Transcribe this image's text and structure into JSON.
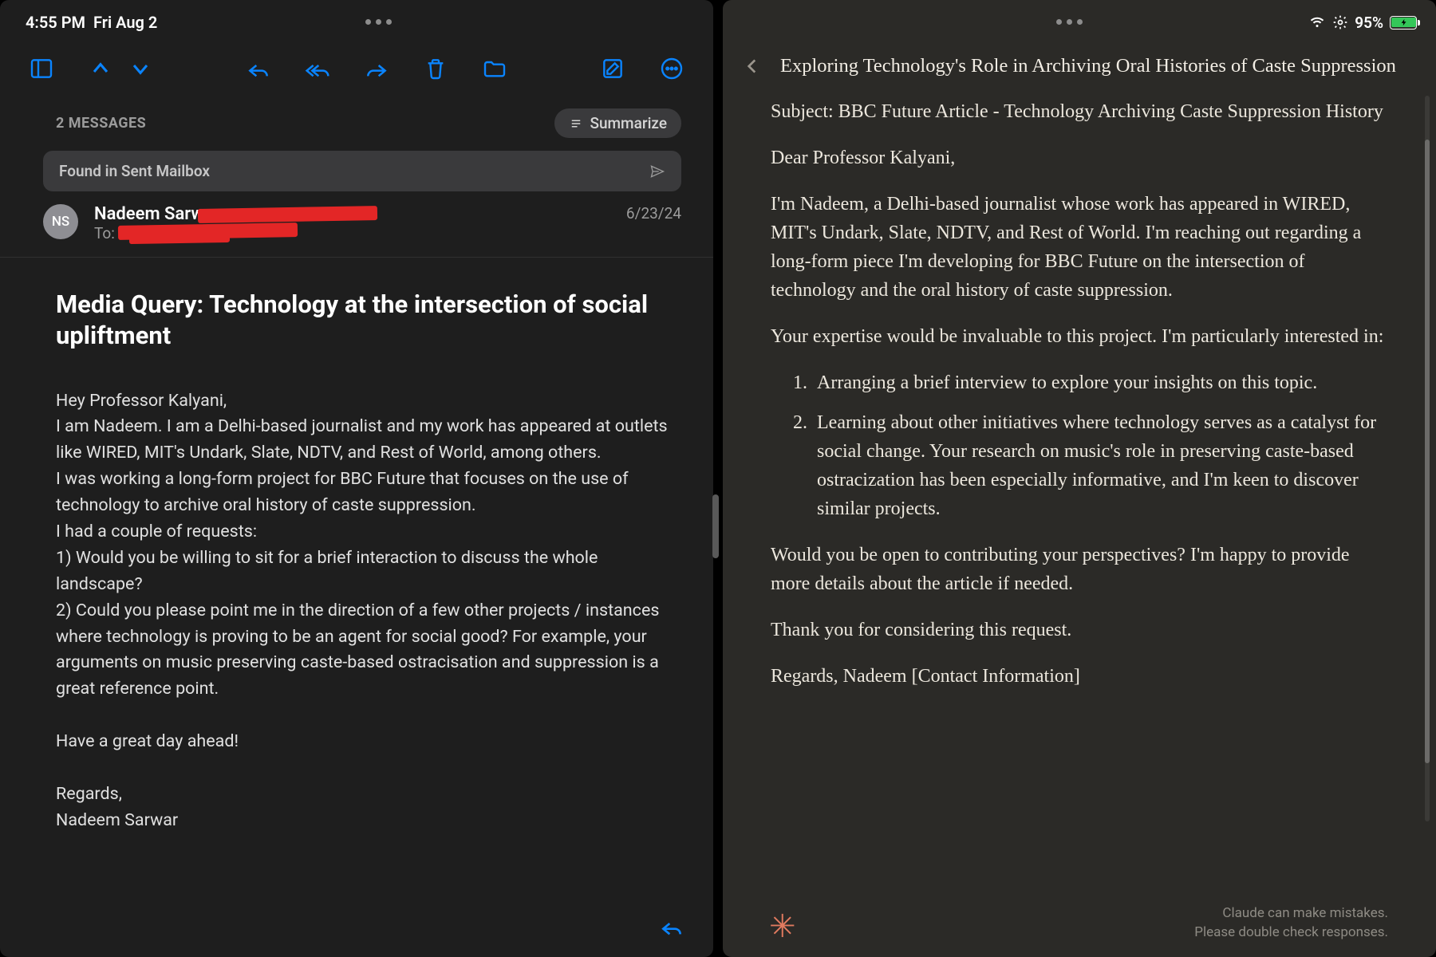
{
  "status_bar": {
    "time": "4:55 PM",
    "date": "Fri Aug 2",
    "battery_pct": "95%"
  },
  "mail": {
    "msg_count": "2 MESSAGES",
    "summarize_label": "Summarize",
    "found_banner": "Found in Sent Mailbox",
    "sender": {
      "initials": "NS",
      "name": "Nadeem Sarwar",
      "to_label": "To:",
      "date": "6/23/24"
    },
    "subject": "Media Query: Technology at the intersection of social upliftment",
    "body": "Hey Professor Kalyani,\nI am Nadeem. I am a Delhi-based journalist and my work has appeared at outlets like WIRED, MIT's Undark, Slate, NDTV, and Rest of World, among others.\nI was working a long-form project for BBC Future that focuses on the use of technology to archive oral history of caste suppression.\nI had a couple of requests:\n1) Would you be willing to sit for a brief interaction to discuss the whole landscape?\n2) Could you please point me in the direction of a few other projects / instances where technology is proving to be an agent for social good? For example, your arguments on music preserving caste-based ostracisation and suppression is a great reference point.\n\nHave a great day ahead!\n\nRegards,\nNadeem Sarwar"
  },
  "chat": {
    "title": "Exploring Technology's Role in Archiving Oral Histories of Caste Suppression",
    "response": {
      "subject_line": "Subject: BBC Future Article - Technology Archiving Caste Suppression History",
      "greeting": "Dear Professor Kalyani,",
      "intro": "I'm Nadeem, a Delhi-based journalist whose work has appeared in WIRED, MIT's Undark, Slate, NDTV, and Rest of World. I'm reaching out regarding a long-form piece I'm developing for BBC Future on the intersection of technology and the oral history of caste suppression.",
      "lead_in": "Your expertise would be invaluable to this project. I'm particularly interested in:",
      "item1": "Arranging a brief interview to explore your insights on this topic.",
      "item2": "Learning about other initiatives where technology serves as a catalyst for social change. Your research on music's role in preserving caste-based ostracization has been especially informative, and I'm keen to discover similar projects.",
      "ask": "Would you be open to contributing your perspectives? I'm happy to provide more details about the article if needed.",
      "thanks": "Thank you for considering this request.",
      "signoff": "Regards, Nadeem [Contact Information]"
    },
    "disclaimer_line1": "Claude can make mistakes.",
    "disclaimer_line2": "Please double check responses."
  }
}
